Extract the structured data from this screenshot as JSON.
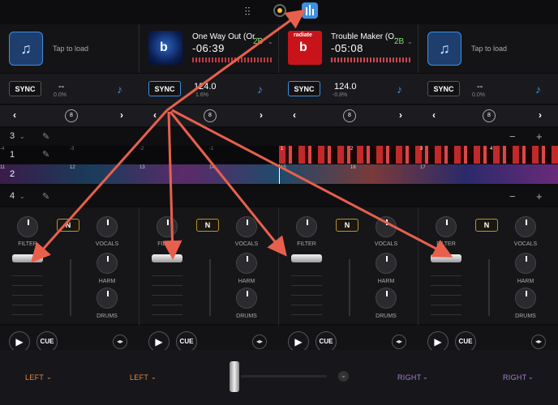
{
  "toolbar": {
    "sliders_icon": "sliders-icon",
    "record_icon": "record-icon",
    "mixer_icon": "mixer-icon"
  },
  "decks": [
    {
      "load_label": "Tap to load",
      "sync": "SYNC",
      "bpm": "--",
      "pitch": "0.0%",
      "loop": "8",
      "layer": "3"
    },
    {
      "title": "One Way Out (Or...",
      "time": "-06:39",
      "key": "2B",
      "sync": "SYNC",
      "bpm": "124.0",
      "pitch": "1.6%",
      "loop": "8",
      "layer": "1"
    },
    {
      "title": "Trouble Maker (O...",
      "time": "-05:08",
      "key": "2B",
      "sync": "SYNC",
      "bpm": "124.0",
      "pitch": "-0.8%",
      "loop": "8",
      "layer": "2"
    },
    {
      "load_label": "Tap to load",
      "sync": "SYNC",
      "bpm": "--",
      "pitch": "0.0%",
      "loop": "8",
      "layer": "4"
    }
  ],
  "wave1_ticks": [
    "-4",
    "-3",
    "-2",
    "-1",
    "1",
    "2",
    "3",
    "4"
  ],
  "wave2_ticks": [
    "11",
    "12",
    "13",
    "14",
    "15",
    "16",
    "17"
  ],
  "controls": {
    "filter": "FILTER",
    "vocals": "VOCALS",
    "harm": "HARM",
    "drums": "DRUMS",
    "n": "N",
    "cue": "CUE"
  },
  "outputs": [
    "LEFT",
    "LEFT",
    "RIGHT",
    "RIGHT"
  ],
  "colors": {
    "accent": "#3d8fe0",
    "key": "#7ddc6c",
    "left": "#e8893a",
    "right": "#a67fd8",
    "arrow": "#e8604c"
  }
}
